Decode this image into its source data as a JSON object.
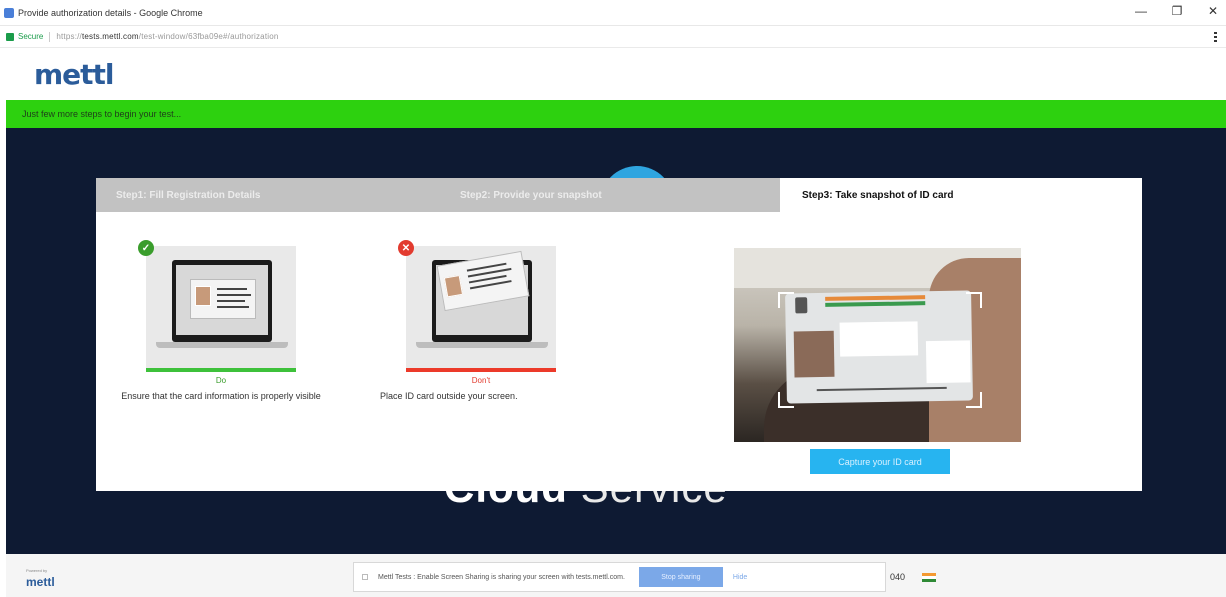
{
  "browser": {
    "title": "Provide authorization details - Google Chrome",
    "secure_label": "Secure",
    "url_prefix": "https://",
    "url_domain": "tests.mettl.com",
    "url_path": "/test-window/63fba09e#/authorization",
    "controls": [
      "—",
      "❐",
      "✕"
    ]
  },
  "site": {
    "logo": "mettl",
    "banner": "Just few more steps to begin your test..."
  },
  "background": {
    "headline_bold": "Cloud",
    "headline_light": " Service"
  },
  "modal": {
    "steps": [
      {
        "label": "Step1: Fill Registration Details"
      },
      {
        "label": "Step2: Provide your snapshot"
      },
      {
        "label": "Step3: Take snapshot of ID card"
      }
    ],
    "examples": {
      "ok": {
        "verdict": "Do",
        "caption": "Ensure that the card information is properly visible"
      },
      "bad": {
        "verdict": "Don't",
        "caption": "Place ID card outside your screen."
      }
    },
    "capture_button": "Capture your ID card"
  },
  "footer": {
    "powered_by": "Powered by",
    "brand": "mettl",
    "share_message": "Mettl Tests : Enable Screen Sharing is sharing your screen with tests.mettl.com.",
    "stop_button": "Stop sharing",
    "hide_link": "Hide",
    "phone_partial": "040"
  },
  "colors": {
    "banner_green": "#2dd10f",
    "stage_navy": "#0e1a33",
    "accent_blue": "#27b4f0",
    "ok_green": "#3a9d2c",
    "bad_red": "#e23b2f"
  }
}
